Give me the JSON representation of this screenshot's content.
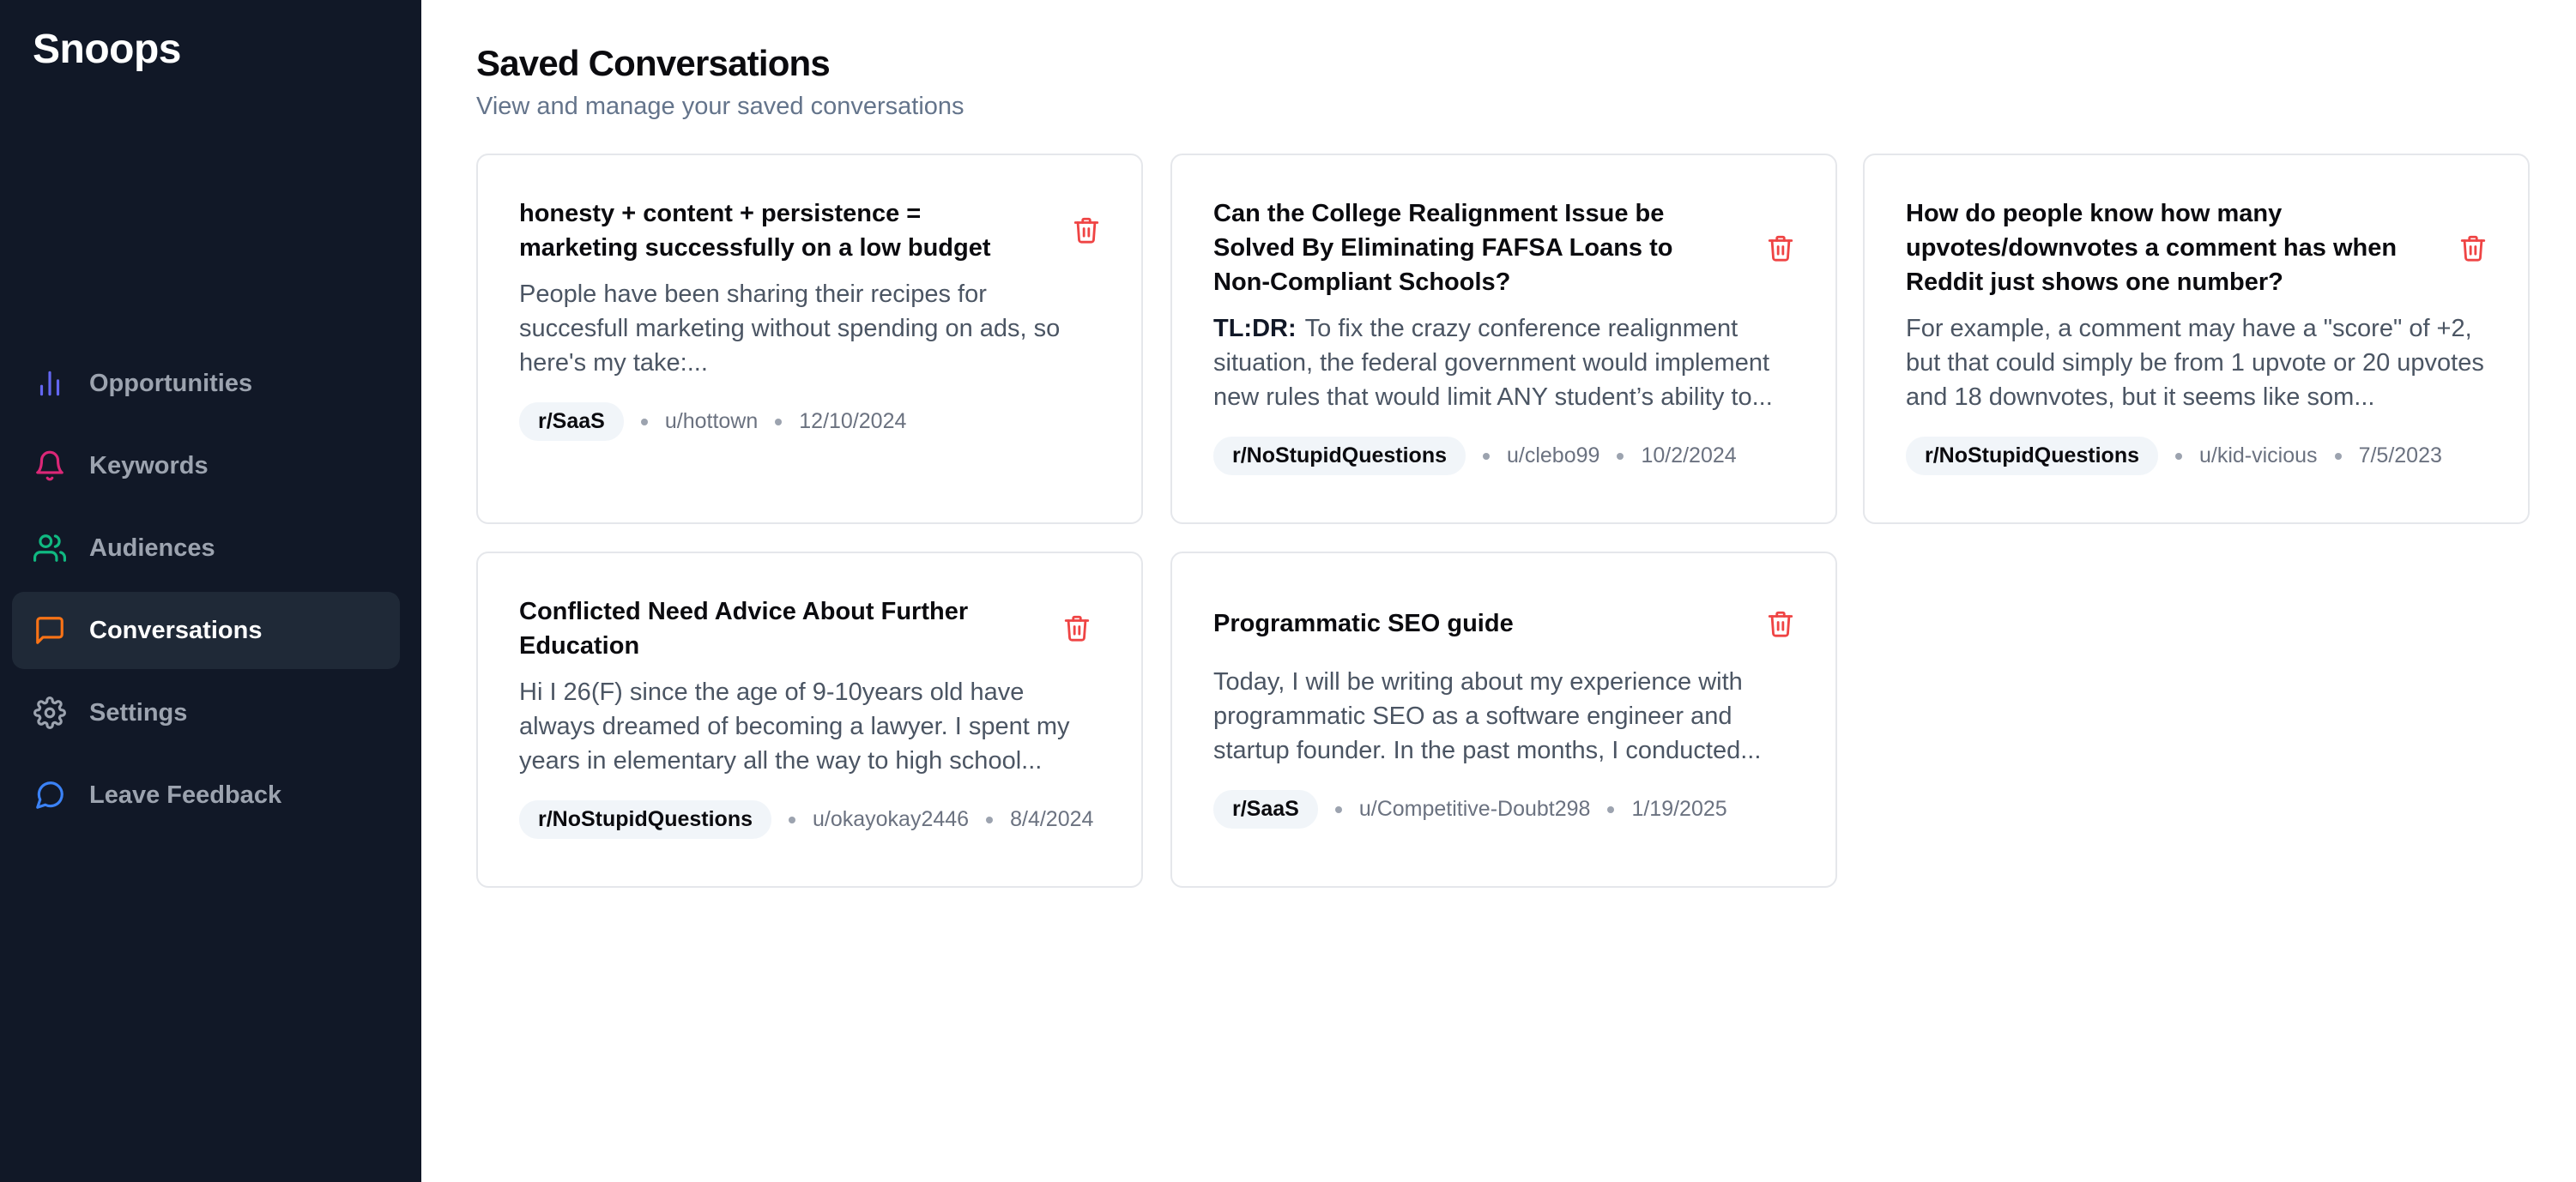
{
  "app": {
    "brand": "Snoops"
  },
  "sidebar": {
    "items": [
      {
        "label": "Opportunities",
        "icon": "bar-chart-icon",
        "color": "#6366f1",
        "active": false
      },
      {
        "label": "Keywords",
        "icon": "bell-icon",
        "color": "#db2777",
        "active": false
      },
      {
        "label": "Audiences",
        "icon": "users-icon",
        "color": "#10b981",
        "active": false
      },
      {
        "label": "Conversations",
        "icon": "message-square-icon",
        "color": "#f97316",
        "active": true
      },
      {
        "label": "Settings",
        "icon": "gear-icon",
        "color": "#9ca3af",
        "active": false
      },
      {
        "label": "Leave Feedback",
        "icon": "message-circle-icon",
        "color": "#3b82f6",
        "active": false
      }
    ]
  },
  "page": {
    "title": "Saved Conversations",
    "subtitle": "View and manage your saved conversations"
  },
  "colors": {
    "delete": "#ef4444",
    "sidebar_bg": "#111827",
    "active_bg": "#1f2937"
  },
  "conversations": [
    {
      "title": "honesty + content + persistence = marketing successfully on a low budget",
      "tldr": "",
      "body": "People have been sharing their recipes for succesfull marketing without spending on ads, so here's my take:...",
      "subreddit": "r/SaaS",
      "user": "u/hottown",
      "date": "12/10/2024"
    },
    {
      "title": "Can the College Realignment Issue be Solved By Eliminating FAFSA Loans to Non-Compliant Schools?",
      "tldr": "TL:DR:",
      "body": "To fix the crazy conference realignment situation, the federal government would implement new rules that would limit ANY student’s ability to...",
      "subreddit": "r/NoStupidQuestions",
      "user": "u/clebo99",
      "date": "10/2/2024"
    },
    {
      "title": "How do people know how many upvotes/downvotes a comment has when Reddit just shows one number?",
      "tldr": "",
      "body": "For example, a comment may have a \"score\" of +2, but that could simply be from 1 upvote or 20 upvotes and 18 downvotes, but it seems like som...",
      "subreddit": "r/NoStupidQuestions",
      "user": "u/kid-vicious",
      "date": "7/5/2023"
    },
    {
      "title": "Conflicted Need Advice About Further Education",
      "tldr": "",
      "body": "Hi I 26(F) since the age of 9-10years old have always dreamed of becoming a lawyer. I spent my years in elementary all the way to high school...",
      "subreddit": "r/NoStupidQuestions",
      "user": "u/okayokay2446",
      "date": "8/4/2024"
    },
    {
      "title": "Programmatic SEO guide",
      "tldr": "",
      "body": "Today, I will be writing about my experience with programmatic SEO as a software engineer and startup founder. In the past months, I conducted...",
      "subreddit": "r/SaaS",
      "user": "u/Competitive-Doubt298",
      "date": "1/19/2025"
    }
  ]
}
